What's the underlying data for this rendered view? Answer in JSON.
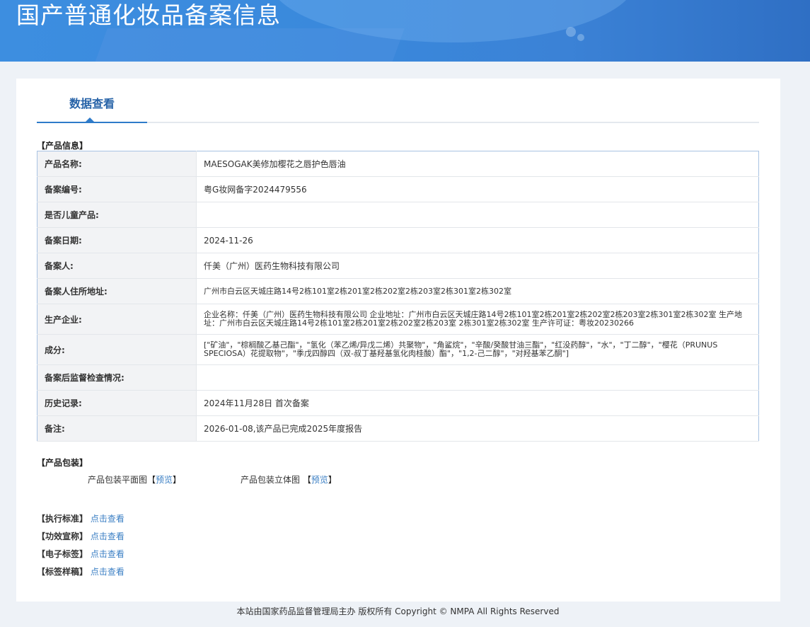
{
  "header": {
    "title": "国产普通化妆品备案信息"
  },
  "tabs": [
    {
      "label": "数据查看"
    }
  ],
  "product_info": {
    "section_label": "【产品信息】",
    "rows": [
      {
        "key": "产品名称:",
        "value": "MAESOGAK美修加樱花之唇护色唇油"
      },
      {
        "key": "备案编号:",
        "value": "粤G妆网备字2024479556"
      },
      {
        "key": "是否儿童产品:",
        "value": ""
      },
      {
        "key": "备案日期:",
        "value": "2024-11-26"
      },
      {
        "key": "备案人:",
        "value": "仟美（广州）医药生物科技有限公司"
      },
      {
        "key": "备案人住所地址:",
        "value": "广州市白云区天城庄路14号2栋101室2栋201室2栋202室2栋203室2栋301室2栋302室"
      },
      {
        "key": "生产企业:",
        "value": "企业名称：仟美（广州）医药生物科技有限公司 企业地址：广州市白云区天城庄路14号2栋101室2栋201室2栋202室2栋203室2栋301室2栋302室 生产地址：广州市白云区天城庄路14号2栋101室2栋201室2栋202室2栋203室 2栋301室2栋302室 生产许可证：粤妆20230266"
      },
      {
        "key": "成分:",
        "value": "[\"矿油\"，\"棕榈酸乙基己酯\"，\"氢化（苯乙烯/异戊二烯）共聚物\"，\"角鲨烷\"，\"辛酸/癸酸甘油三酯\"，\"红没药醇\"，\"水\"，\"丁二醇\"，\"樱花（PRUNUS SPECIOSA）花提取物\"，\"季戊四醇四（双-叔丁基羟基氢化肉桂酸）酯\"，\"1,2-己二醇\"，\"对羟基苯乙酮\"]"
      },
      {
        "key": "备案后监督检查情况:",
        "value": ""
      },
      {
        "key": "历史记录:",
        "value": "2024年11月28日 首次备案"
      },
      {
        "key": "备注:",
        "value": "2026-01-08,该产品已完成2025年度报告"
      }
    ]
  },
  "packaging": {
    "section_label": "【产品包装】",
    "flat_label": "产品包装平面图",
    "flat_link": "预览",
    "solid_label": "产品包装立体图",
    "solid_link": "预览"
  },
  "links": [
    {
      "label": "【执行标准】",
      "link": "点击查看"
    },
    {
      "label": "【功效宣称】",
      "link": "点击查看"
    },
    {
      "label": "【电子标签】",
      "link": "点击查看"
    },
    {
      "label": "【标签样稿】",
      "link": "点击查看"
    }
  ],
  "footer": {
    "text": "本站由国家药品监督管理局主办 版权所有 Copyright © NMPA All Rights Reserved"
  },
  "colors": {
    "banner": "#3a89dc",
    "accent": "#2e7bc9",
    "link": "#3b7fc4"
  }
}
